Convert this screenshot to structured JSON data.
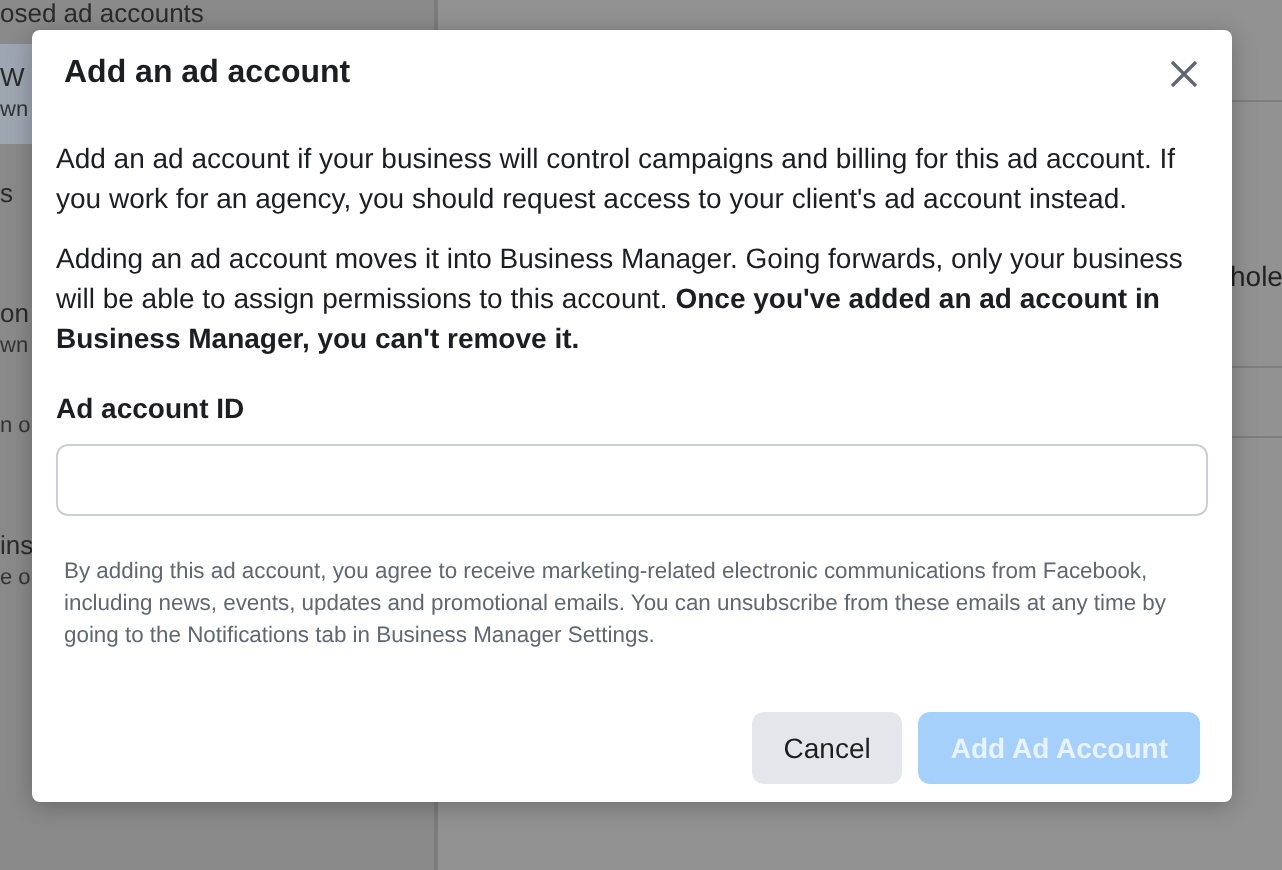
{
  "sidebar": {
    "heading": "osed ad accounts",
    "items": [
      {
        "title": "W",
        "subtitle": "wn",
        "selected": true
      },
      {
        "title": "s",
        "selected": false
      },
      {
        "title": "on",
        "subtitle": "wn",
        "selected": false
      },
      {
        "subtitle": "n o",
        "selected": false
      },
      {
        "title": "ins",
        "subtitle": "e o",
        "selected": false
      }
    ]
  },
  "main": {
    "fragment": "hole"
  },
  "dialog": {
    "title": "Add an ad account",
    "paragraphs": [
      "Add an ad account if your business will control campaigns and billing for this ad account. If you work for an agency, you should request access to your client's ad account instead.",
      "Adding an ad account moves it into Business Manager. Going forwards, only your business will be able to assign permissions to this account. **Once you've added an ad account in Business Manager, you can't remove it.**"
    ],
    "field": {
      "label": "Ad account ID"
    },
    "disclaimer": "By adding this ad account, you agree to receive marketing-related electronic communications from Facebook, including news, events, updates and promotional emails. You can unsubscribe from these emails at any time by going to the Notifications tab in Business Manager Settings.",
    "buttons": [
      {
        "label": "Cancel",
        "kind": "secondary",
        "disabled": false
      },
      {
        "label": "Add Ad Account",
        "kind": "primary",
        "disabled": true
      }
    ]
  }
}
